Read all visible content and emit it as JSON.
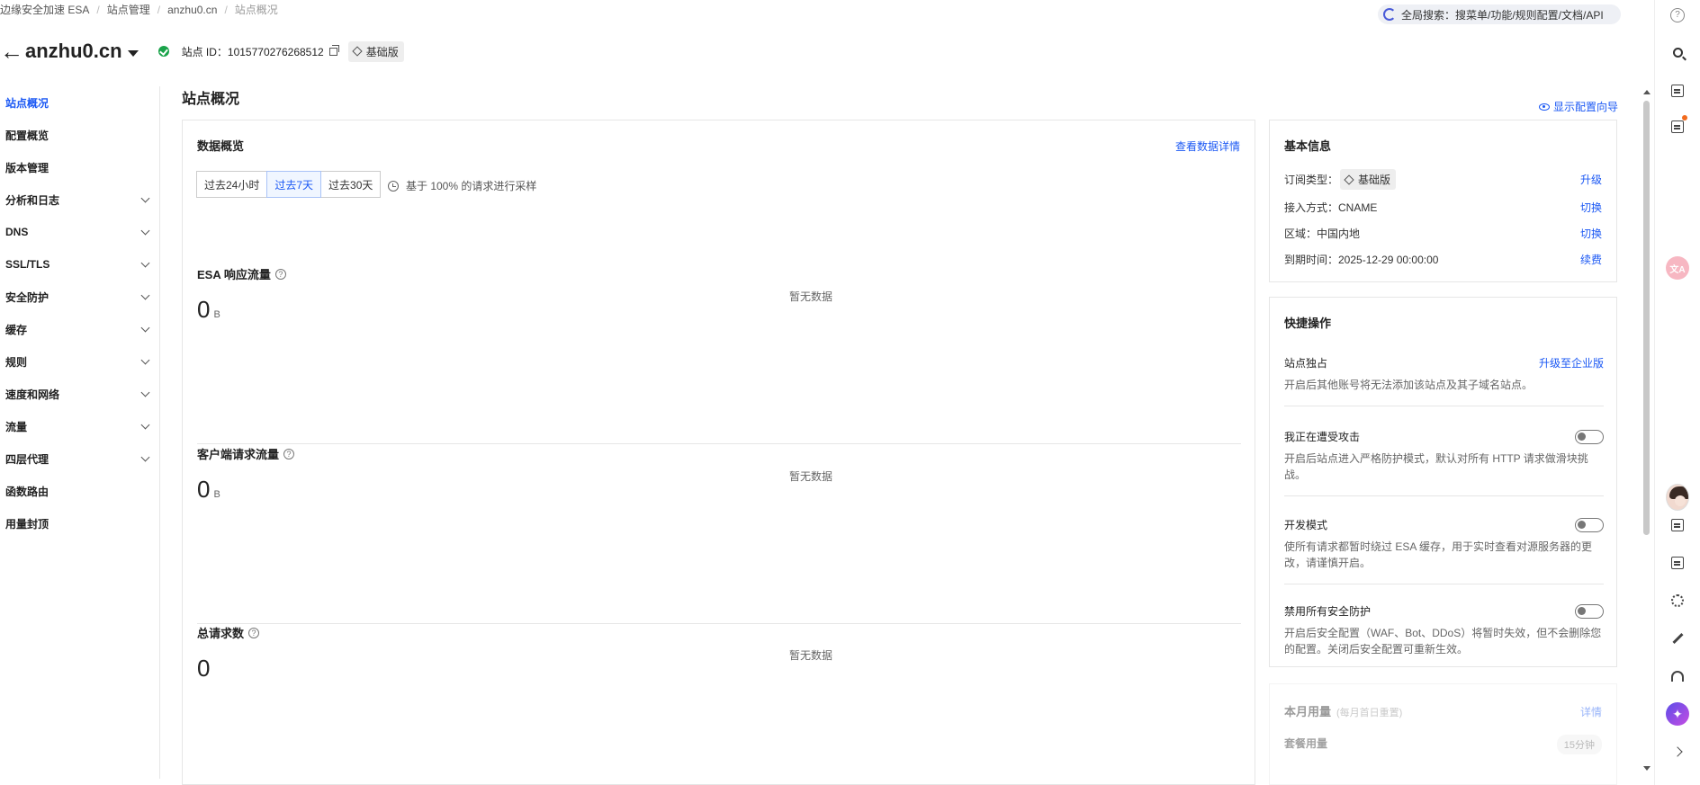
{
  "breadcrumb": [
    "边缘安全加速 ESA",
    "站点管理",
    "anzhu0.cn",
    "站点概况"
  ],
  "global_search": "全局搜索：搜菜单/功能/规则配置/文档/API",
  "site": {
    "name": "anzhu0.cn",
    "id_label": "站点 ID：1015770276268512",
    "plan": "基础版"
  },
  "sidebar": {
    "items": [
      {
        "label": "站点概况",
        "active": true,
        "expand": false
      },
      {
        "label": "配置概览",
        "active": false,
        "expand": false
      },
      {
        "label": "版本管理",
        "active": false,
        "expand": false
      },
      {
        "label": "分析和日志",
        "active": false,
        "expand": true
      },
      {
        "label": "DNS",
        "active": false,
        "expand": true
      },
      {
        "label": "SSL/TLS",
        "active": false,
        "expand": true
      },
      {
        "label": "安全防护",
        "active": false,
        "expand": true
      },
      {
        "label": "缓存",
        "active": false,
        "expand": true
      },
      {
        "label": "规则",
        "active": false,
        "expand": true
      },
      {
        "label": "速度和网络",
        "active": false,
        "expand": true
      },
      {
        "label": "流量",
        "active": false,
        "expand": true
      },
      {
        "label": "四层代理",
        "active": false,
        "expand": true
      },
      {
        "label": "函数路由",
        "active": false,
        "expand": false
      },
      {
        "label": "用量封顶",
        "active": false,
        "expand": false
      }
    ]
  },
  "main": {
    "title": "站点概况",
    "guide_link": "显示配置向导",
    "overview": {
      "title": "数据概览",
      "detail_link": "查看数据详情",
      "ranges": [
        "过去24小时",
        "过去7天",
        "过去30天"
      ],
      "selected_range": 1,
      "sampling": "基于 100% 的请求进行采样",
      "metrics": [
        {
          "title": "ESA 响应流量",
          "value": "0",
          "unit": "B",
          "nodata": "暂无数据"
        },
        {
          "title": "客户端请求流量",
          "value": "0",
          "unit": "B",
          "nodata": "暂无数据"
        },
        {
          "title": "总请求数",
          "value": "0",
          "unit": "",
          "nodata": "暂无数据"
        }
      ]
    }
  },
  "info": {
    "title": "基本信息",
    "subscription_label": "订阅类型：",
    "subscription_value": "基础版",
    "upgrade": "升级",
    "access": "接入方式：CNAME",
    "access_action": "切换",
    "region": "区域：中国内地",
    "region_action": "切换",
    "expire": "到期时间：2025-12-29 00:00:00",
    "renew": "续费"
  },
  "quick": {
    "title": "快捷操作",
    "items": [
      {
        "title": "站点独占",
        "action": "升级至企业版",
        "desc": "开启后其他账号将无法添加该站点及其子域名站点。",
        "toggle": false
      },
      {
        "title": "我正在遭受攻击",
        "action": "",
        "desc": "开启后站点进入严格防护模式，默认对所有 HTTP 请求做滑块挑战。",
        "toggle": true
      },
      {
        "title": "开发模式",
        "action": "",
        "desc": "使所有请求都暂时绕过 ESA 缓存，用于实时查看对源服务器的更改，请谨慎开启。",
        "toggle": true
      },
      {
        "title": "禁用所有安全防护",
        "action": "",
        "desc": "开启后安全配置（WAF、Bot、DDoS）将暂时失效，但不会删除您的配置。关闭后安全配置可重新生效。",
        "toggle": true
      }
    ]
  },
  "usage": {
    "title": "本月用量",
    "subtitle": "(每月首日重置)",
    "detail": "详情",
    "package": "套餐用量",
    "tag": "15分钟"
  },
  "rail": {
    "translate_label": "文A"
  }
}
